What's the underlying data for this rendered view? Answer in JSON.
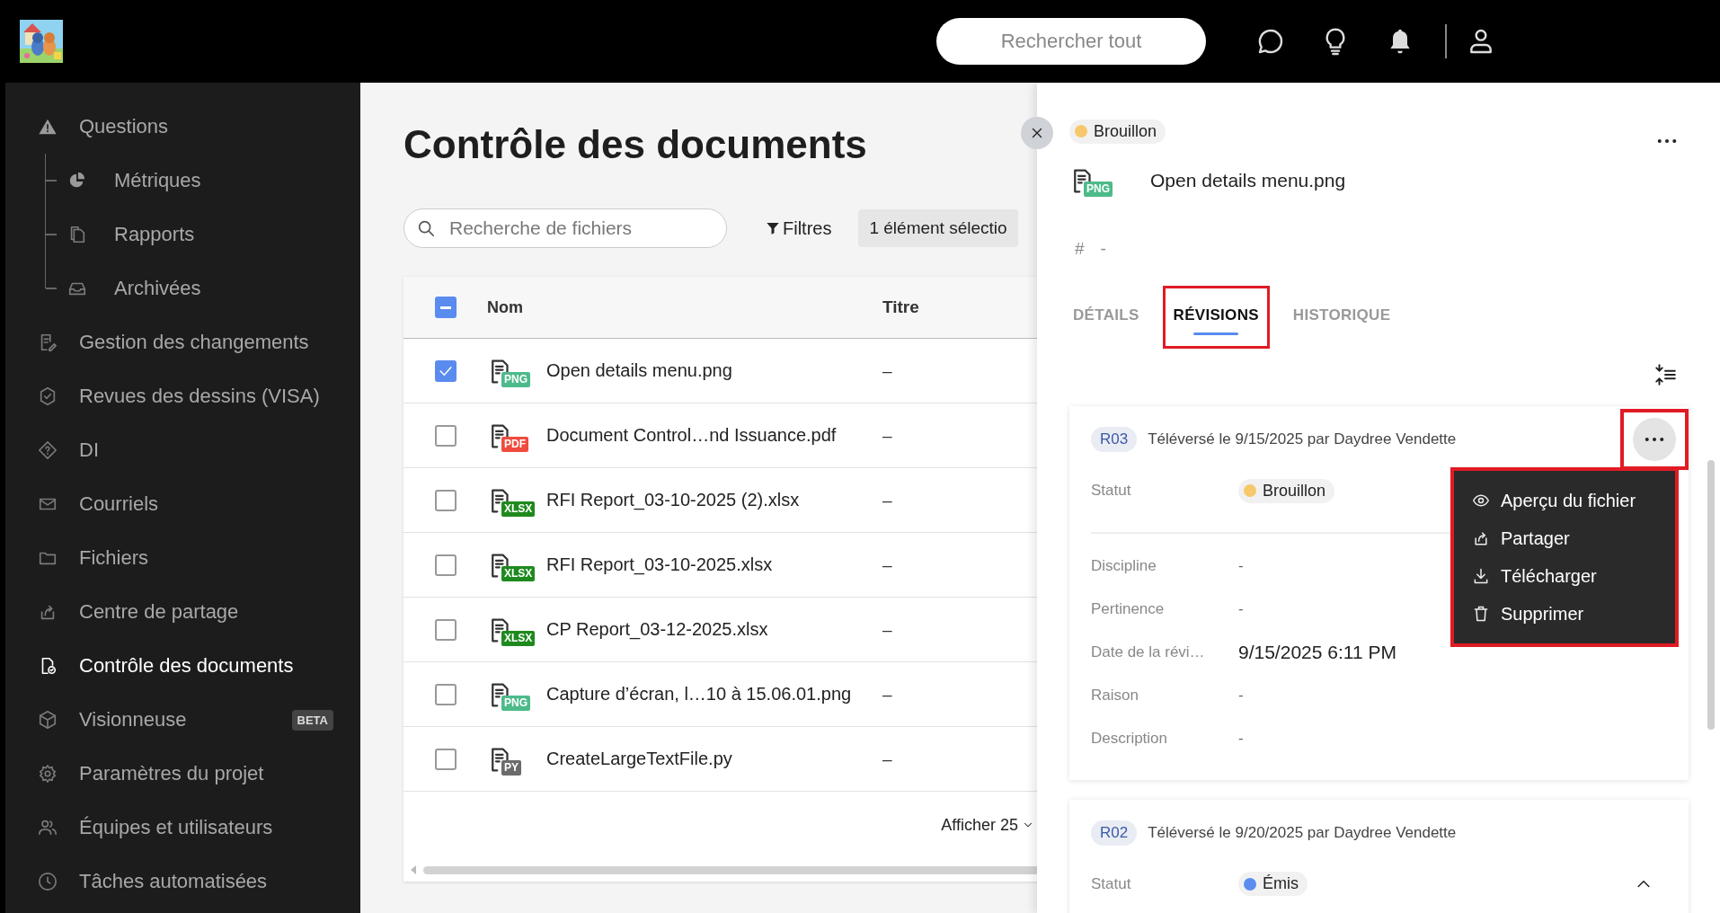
{
  "top_bar": {
    "search": {
      "placeholder": "Rechercher tout"
    }
  },
  "sidebar": {
    "items": [
      {
        "label": "Questions",
        "selected": false,
        "children": [
          {
            "label": "Métriques",
            "selected": false
          },
          {
            "label": "Rapports",
            "selected": false
          },
          {
            "label": "Archivées",
            "selected": false
          }
        ]
      },
      {
        "label": "Gestion des changements",
        "selected": false
      },
      {
        "label": "Revues des dessins (VISA)",
        "selected": false
      },
      {
        "label": "DI",
        "selected": false
      },
      {
        "label": "Courriels",
        "selected": false
      },
      {
        "label": "Fichiers",
        "selected": false
      },
      {
        "label": "Centre de partage",
        "selected": false
      },
      {
        "label": "Contrôle des documents",
        "selected": true
      },
      {
        "label": "Visionneuse",
        "selected": false,
        "badge": "BETA"
      },
      {
        "label": "Paramètres du projet",
        "selected": false
      },
      {
        "label": "Équipes et utilisateurs",
        "selected": false
      },
      {
        "label": "Tâches automatisées",
        "selected": false
      }
    ]
  },
  "main": {
    "title": "Contrôle des documents",
    "search": {
      "placeholder": "Recherche de fichiers"
    },
    "filter_button": "Filtres",
    "selection_chip": "1 élément sélectio",
    "table": {
      "select_all": {
        "checked": true,
        "indeterminate": true
      },
      "columns": [
        "Nom",
        "Titre"
      ],
      "rows": [
        {
          "selected": true,
          "badge": {
            "text": "PNG",
            "color": "#4dba8a"
          },
          "name": "Open details menu.png",
          "title": "–"
        },
        {
          "selected": false,
          "badge": {
            "text": "PDF",
            "color": "#ef4b3f"
          },
          "name": "Document Control…nd Issuance.pdf",
          "title": "–"
        },
        {
          "selected": false,
          "badge": {
            "text": "XLSX",
            "color": "#1e8a1e"
          },
          "name": "RFI Report_03-10-2025 (2).xlsx",
          "title": "–"
        },
        {
          "selected": false,
          "badge": {
            "text": "XLSX",
            "color": "#1e8a1e"
          },
          "name": "RFI Report_03-10-2025.xlsx",
          "title": "–"
        },
        {
          "selected": false,
          "badge": {
            "text": "XLSX",
            "color": "#1e8a1e"
          },
          "name": "CP Report_03-12-2025.xlsx",
          "title": "–"
        },
        {
          "selected": false,
          "badge": {
            "text": "PNG",
            "color": "#4dba8a"
          },
          "name": "Capture d’écran, l…10 à 15.06.01.png",
          "title": "–"
        },
        {
          "selected": false,
          "badge": {
            "text": "PY",
            "color": "#6b6b6b"
          },
          "name": "CreateLargeTextFile.py",
          "title": "–"
        }
      ],
      "page_size": "Afficher 25"
    }
  },
  "details_panel": {
    "status": {
      "text": "Brouillon",
      "color": "#f7c86b"
    },
    "file": {
      "badge": {
        "text": "PNG",
        "color": "#4dba8a"
      },
      "name": "Open details menu.png"
    },
    "number_label": "#",
    "number_value": "-",
    "tabs": [
      {
        "label": "DÉTAILS",
        "selected": false,
        "highlighted": false
      },
      {
        "label": "RÉVISIONS",
        "selected": true,
        "highlighted": true
      },
      {
        "label": "HISTORIQUE",
        "selected": false,
        "highlighted": false
      }
    ],
    "revisions": [
      {
        "code": "R03",
        "uploaded": "Téléversé le 9/15/2025 par Daydree Vendette",
        "more_button": {
          "highlighted": true
        },
        "status_label": "Statut",
        "status": {
          "text": "Brouillon",
          "color": "#f7c86b"
        },
        "fields": [
          {
            "label": "Discipline",
            "value": "-"
          },
          {
            "label": "Pertinence",
            "value": "-"
          },
          {
            "label": "Date de la révi…",
            "value": "9/15/2025 6:11 PM"
          },
          {
            "label": "Raison",
            "value": "-"
          },
          {
            "label": "Description",
            "value": "-"
          }
        ],
        "menu": {
          "highlighted": true,
          "items": [
            "Aperçu du fichier",
            "Partager",
            "Télécharger",
            "Supprimer"
          ]
        }
      },
      {
        "code": "R02",
        "uploaded": "Téléversé le 9/20/2025 par Daydree Vendette",
        "status_label": "Statut",
        "status": {
          "text": "Émis",
          "color": "#5b8def"
        },
        "expanded": true
      }
    ]
  }
}
